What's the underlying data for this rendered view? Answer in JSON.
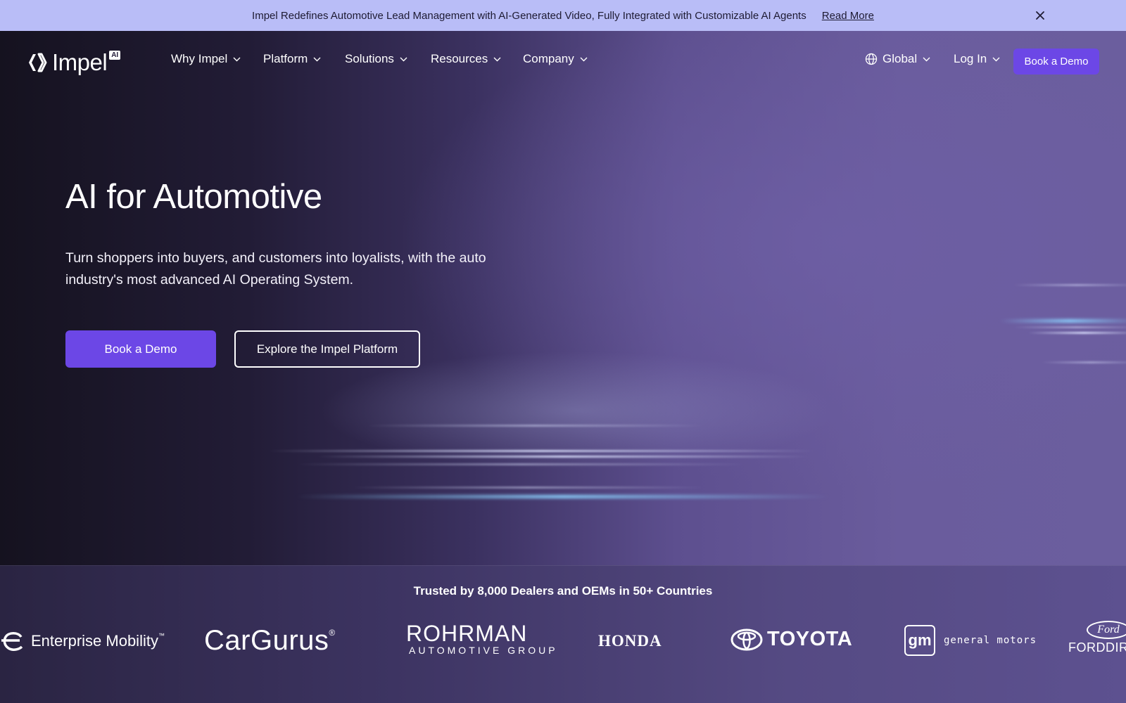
{
  "announcement": {
    "message": "Impel Redefines Automotive Lead Management with AI-Generated Video, Fully Integrated with Customizable AI Agents",
    "link_label": "Read More",
    "close_icon": "close-icon"
  },
  "header": {
    "logo_text": "Impel",
    "logo_badge": "AI",
    "nav": [
      {
        "label": "Why Impel"
      },
      {
        "label": "Platform"
      },
      {
        "label": "Solutions"
      },
      {
        "label": "Resources"
      },
      {
        "label": "Company"
      }
    ],
    "region_label": "Global",
    "region_icon": "globe-icon",
    "login_label": "Log In",
    "cta_label": "Book a Demo"
  },
  "hero": {
    "title": "AI for Automotive",
    "subtitle": "Turn shoppers into buyers, and customers into loyalists, with the auto industry's most advanced AI Operating System.",
    "primary_button": "Book a Demo",
    "secondary_button": "Explore the Impel Platform"
  },
  "trusted": {
    "title": "Trusted by 8,000 Dealers and OEMs in 50+ Countries",
    "logos": [
      {
        "name": "Enterprise Mobility",
        "mark": "™"
      },
      {
        "name": "CarGurus",
        "mark": "®"
      },
      {
        "name": "ROHRMAN",
        "tagline": "AUTOMOTIVE GROUP"
      },
      {
        "name": "HONDA"
      },
      {
        "name": "TOYOTA"
      },
      {
        "name": "general motors",
        "mark": "gm"
      },
      {
        "name": "FORDDIR",
        "mark": "Ford"
      }
    ]
  },
  "colors": {
    "announcement_bg": "#b9bdf7",
    "accent": "#6c47e6",
    "hero_dark": "#15121f",
    "hero_light": "#6b5e9e"
  }
}
